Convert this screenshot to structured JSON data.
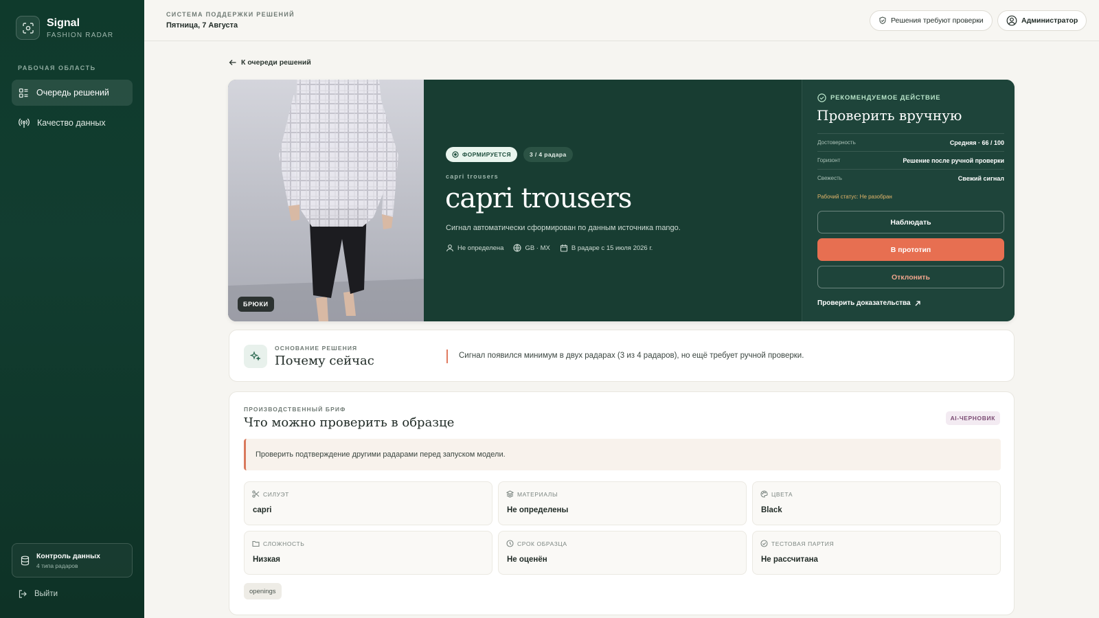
{
  "brand": {
    "title": "Signal",
    "subtitle": "FASHION RADAR"
  },
  "sidebar": {
    "section_label": "РАБОЧАЯ ОБЛАСТЬ",
    "items": [
      {
        "label": "Очередь решений",
        "icon": "queue-icon",
        "active": true
      },
      {
        "label": "Качество данных",
        "icon": "radar-icon",
        "active": false
      }
    ],
    "data_control": {
      "title": "Контроль данных",
      "subtitle": "4 типа радаров"
    },
    "logout_label": "Выйти"
  },
  "header": {
    "kicker": "СИСТЕМА ПОДДЕРЖКИ РЕШЕНИЙ",
    "date": "Пятница, 7 Августа",
    "review_pill": "Решения требуют проверки",
    "user_pill": "Администратор"
  },
  "back_link": "К очереди решений",
  "hero": {
    "image_badge": "БРЮКИ",
    "status_chip": "ФОРМИРУЕТСЯ",
    "radar_chip": "3 / 4 радара",
    "kicker": "capri trousers",
    "title": "capri trousers",
    "description": "Сигнал автоматически сформирован по данным источника mango.",
    "meta": {
      "audience": "Не определена",
      "regions": "GB · MX",
      "since": "В радаре с 15 июля 2026 г."
    }
  },
  "recommendation": {
    "kicker": "РЕКОМЕНДУЕМОЕ ДЕЙСТВИЕ",
    "title": "Проверить вручную",
    "rows": [
      {
        "label": "Достоверность",
        "value": "Средняя · 66 / 100"
      },
      {
        "label": "Горизонт",
        "value": "Решение после ручной проверки"
      },
      {
        "label": "Свежесть",
        "value": "Свежий сигнал"
      }
    ],
    "status": "Рабочий статус: Не разобран",
    "watch_button": "Наблюдать",
    "prototype_button": "В прототип",
    "reject_button": "Отклонить",
    "evidence_link": "Проверить доказательства"
  },
  "why": {
    "kicker": "ОСНОВАНИЕ РЕШЕНИЯ",
    "title": "Почему сейчас",
    "text": "Сигнал появился минимум в двух радарах (3 из 4 радаров), но ещё требует ручной проверки."
  },
  "brief": {
    "kicker": "ПРОИЗВОДСТВЕННЫЙ БРИФ",
    "title": "Что можно проверить в образце",
    "badge": "AI-ЧЕРНОВИК",
    "note": "Проверить подтверждение другими радарами перед запуском модели.",
    "specs": [
      {
        "label": "СИЛУЭТ",
        "value": "capri",
        "icon": "scissors-icon"
      },
      {
        "label": "МАТЕРИАЛЫ",
        "value": "Не определены",
        "icon": "layers-icon"
      },
      {
        "label": "ЦВЕТА",
        "value": "Black",
        "icon": "palette-icon"
      },
      {
        "label": "СЛОЖНОСТЬ",
        "value": "Низкая",
        "icon": "folder-icon"
      },
      {
        "label": "СРОК ОБРАЗЦА",
        "value": "Не оценён",
        "icon": "clock-icon"
      },
      {
        "label": "ТЕСТОВАЯ ПАРТИЯ",
        "value": "Не рассчитана",
        "icon": "check-circle-icon"
      }
    ],
    "tag": "openings"
  },
  "colors": {
    "sidebar_bg": "#0f3a2c",
    "hero_bg": "#183d32",
    "accent": "#e76f51"
  }
}
